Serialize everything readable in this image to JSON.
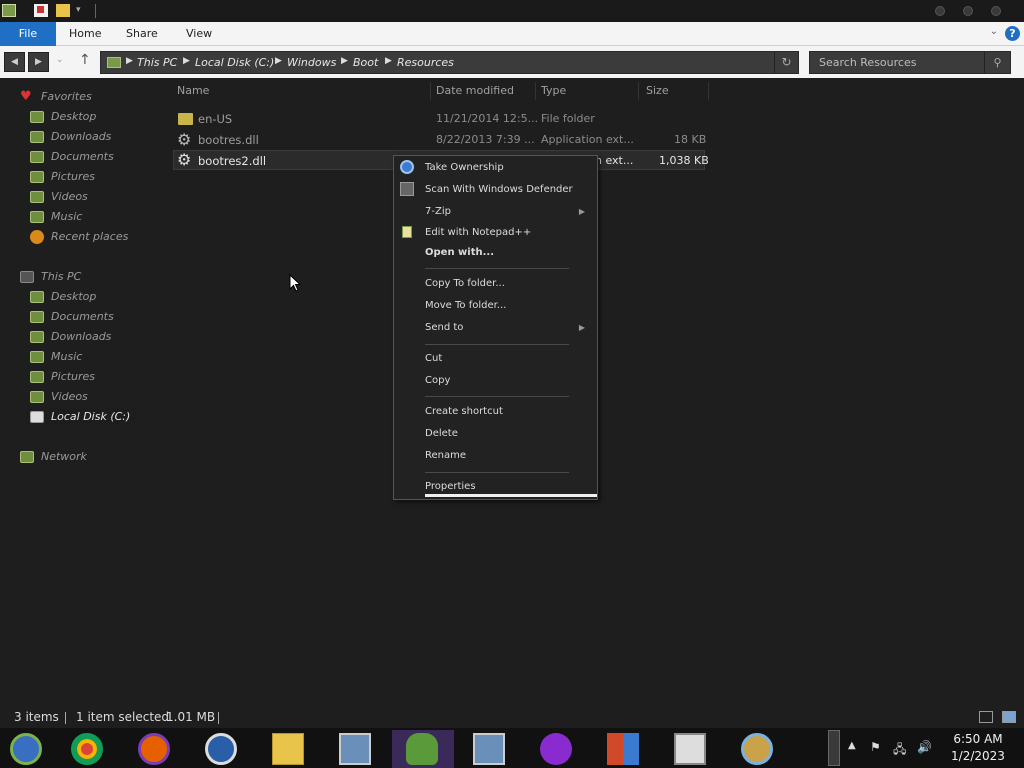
{
  "ribbon": {
    "tabs": [
      "File",
      "Home",
      "Share",
      "View"
    ]
  },
  "address": {
    "crumbs": [
      "This PC",
      "Local Disk (C:)",
      "Windows",
      "Boot",
      "Resources"
    ]
  },
  "search": {
    "placeholder": "Search Resources"
  },
  "nav": {
    "favorites_label": "Favorites",
    "favorites": [
      "Desktop",
      "Downloads",
      "Documents",
      "Pictures",
      "Videos",
      "Music",
      "Recent places"
    ],
    "thispc_label": "This PC",
    "thispc": [
      "Desktop",
      "Documents",
      "Downloads",
      "Music",
      "Pictures",
      "Videos",
      "Local Disk (C:)"
    ],
    "network_label": "Network"
  },
  "columns": {
    "name": "Name",
    "date": "Date modified",
    "type": "Type",
    "size": "Size"
  },
  "files": [
    {
      "name": "en-US",
      "date": "11/21/2014 12:5...",
      "type": "File folder",
      "size": "",
      "icon": "folder-icon"
    },
    {
      "name": "bootres.dll",
      "date": "8/22/2013 7:39 ...",
      "type": "Application ext...",
      "size": "18 KB",
      "icon": "gear-icon"
    },
    {
      "name": "bootres2.dll",
      "date": "",
      "type": "n ext...",
      "size": "1,038 KB",
      "icon": "gear-icon"
    }
  ],
  "context_menu": {
    "take_ownership": "Take Ownership",
    "scan_defender": "Scan With Windows Defender",
    "sevenzip": "7-Zip",
    "edit_notepadpp": "Edit with Notepad++",
    "open_with": "Open with...",
    "copy_to": "Copy To folder...",
    "move_to": "Move To folder...",
    "send_to": "Send to",
    "cut": "Cut",
    "copy": "Copy",
    "create_shortcut": "Create shortcut",
    "delete": "Delete",
    "rename": "Rename",
    "properties": "Properties"
  },
  "status": {
    "items": "3 items",
    "selected": "1 item selected",
    "size": "1.01 MB"
  },
  "clock": {
    "time": "6:50 AM",
    "date": "1/2/2023"
  },
  "colors": {
    "accent": "#1f6fc4",
    "background": "#1e1e1e",
    "folder": "#c8b44a",
    "nav_icon": "#8aa85a"
  }
}
